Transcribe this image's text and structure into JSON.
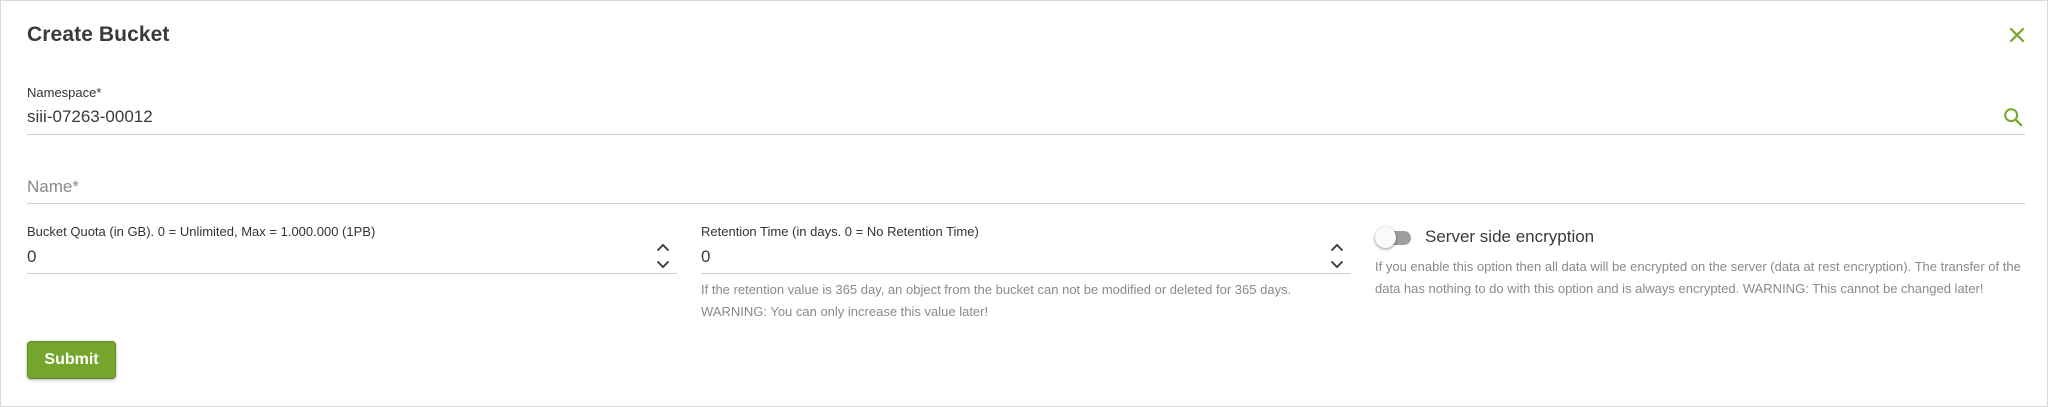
{
  "dialog": {
    "title": "Create Bucket"
  },
  "namespace": {
    "label": "Namespace*",
    "value": "siii-07263-00012"
  },
  "name": {
    "placeholder": "Name*",
    "value": ""
  },
  "quota": {
    "label": "Bucket Quota (in GB). 0 = Unlimited, Max = 1.000.000 (1PB)",
    "value": "0"
  },
  "retention": {
    "label": "Retention Time (in days. 0 = No Retention Time)",
    "value": "0",
    "help": "If the retention value is 365 day, an object from the bucket can not be modified or deleted for 365 days. WARNING: You can only increase this value later!"
  },
  "encryption": {
    "label": "Server side encryption",
    "enabled": false,
    "help": "If you enable this option then all data will be encrypted on the server (data at rest encryption). The transfer of the data has nothing to do with this option and is always encrypted. WARNING: This cannot be changed later!"
  },
  "actions": {
    "submit_label": "Submit"
  },
  "colors": {
    "accent": "#76a52c",
    "text": "#3a3a3a",
    "muted": "#8a8a8a",
    "toggle_off": "#9e9e9e"
  },
  "icons": {
    "close": "close-icon",
    "search": "search-icon",
    "stepper": "chevron-up-down-icon"
  }
}
